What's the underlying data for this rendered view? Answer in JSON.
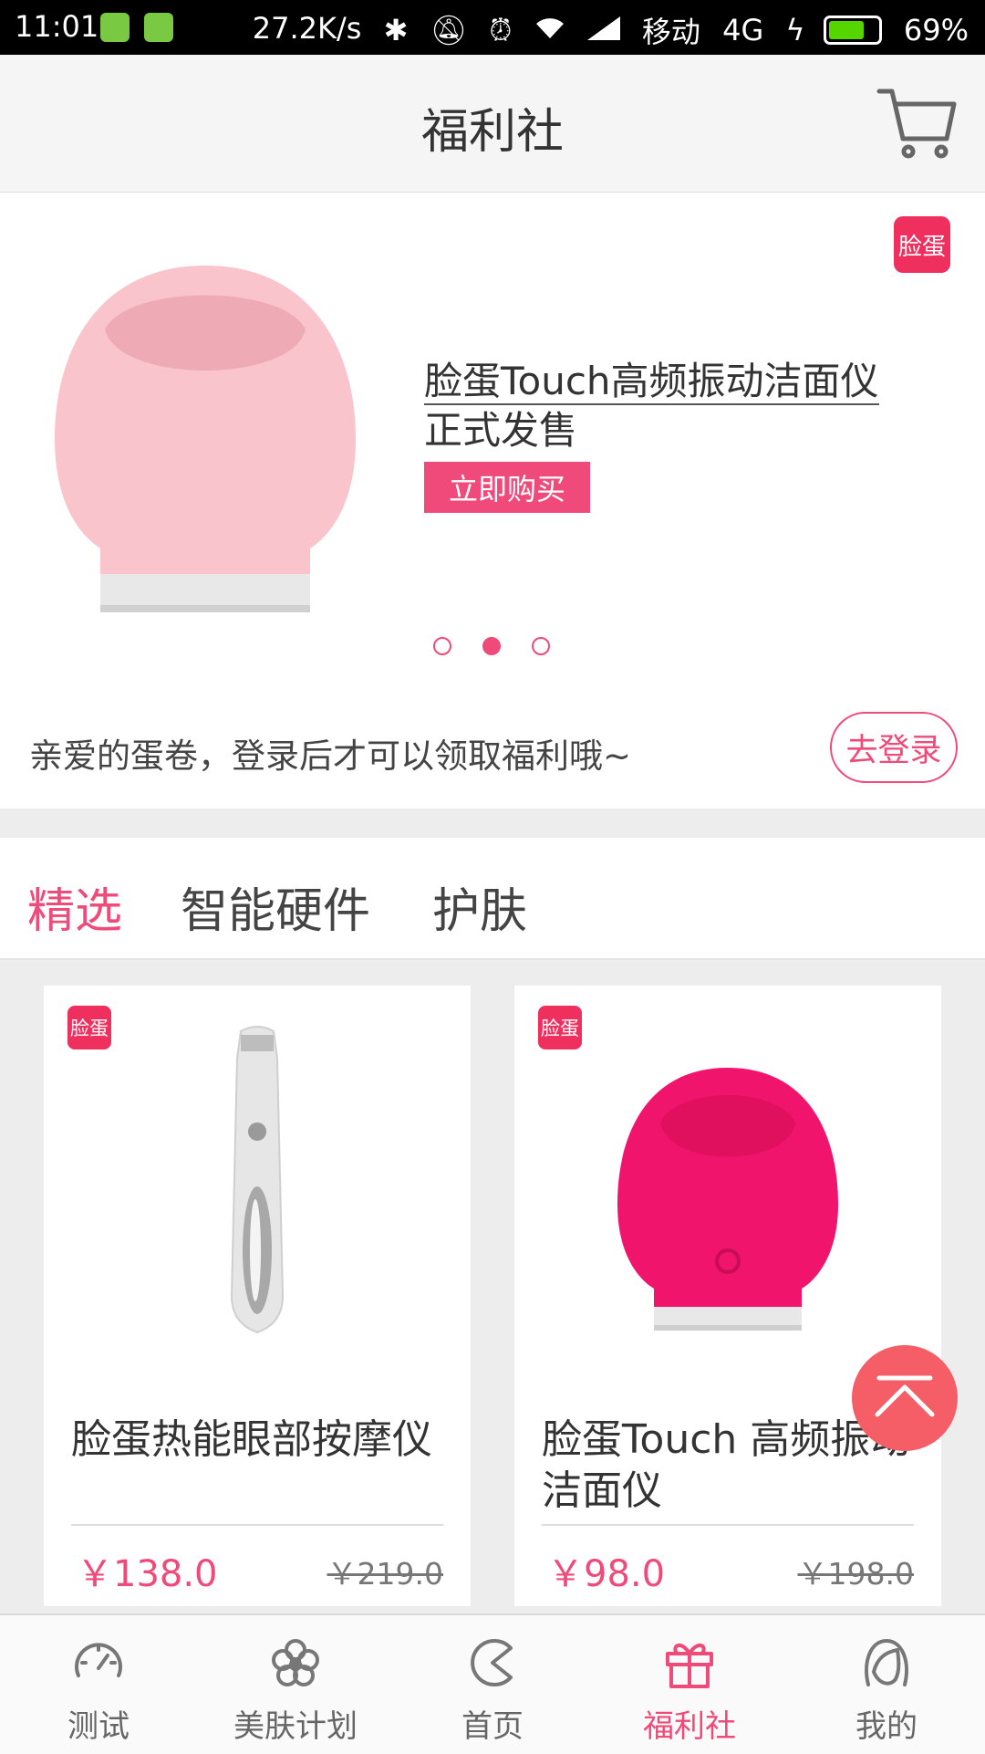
{
  "status_bar": {
    "time": "11:01",
    "speed": "27.2K/s",
    "carrier": "移动",
    "network": "4G",
    "battery": "69%",
    "icons": [
      "battery-app-icon",
      "android-app-icon",
      "bluetooth-icon",
      "mute-bell-icon",
      "alarm-icon",
      "wifi-icon",
      "signal-icon",
      "charging-icon",
      "battery-icon"
    ]
  },
  "header": {
    "title": "福利社",
    "cart_icon": "cart-icon"
  },
  "banner": {
    "brand_badge": "脸蛋",
    "title_line1": "脸蛋Touch高频振动洁面仪",
    "title_line2": "正式发售",
    "buy_label": "立即购买",
    "pagination_active": 2,
    "pagination_count": 3
  },
  "login": {
    "text": "亲爱的蛋卷，登录后才可以领取福利哦~",
    "button": "去登录"
  },
  "tabs": [
    {
      "label": "精选",
      "active": true
    },
    {
      "label": "智能硬件",
      "active": false
    },
    {
      "label": "护肤",
      "active": false
    }
  ],
  "products": [
    {
      "badge": "脸蛋",
      "name": "脸蛋热能眼部按摩仪",
      "price": "￥138.0",
      "old_price": "￥219.0"
    },
    {
      "badge": "脸蛋",
      "name": "脸蛋Touch 高频振动洁面仪",
      "price": "￥98.0",
      "old_price": "￥198.0"
    }
  ],
  "bottom_nav": [
    {
      "label": "测试",
      "icon": "speedometer-icon",
      "active": false
    },
    {
      "label": "美肤计划",
      "icon": "flower-icon",
      "active": false
    },
    {
      "label": "首页",
      "icon": "pacman-icon",
      "active": false
    },
    {
      "label": "福利社",
      "icon": "gift-icon",
      "active": true
    },
    {
      "label": "我的",
      "icon": "girl-face-icon",
      "active": false
    }
  ],
  "colors": {
    "accent": "#ef4a7a",
    "brand_badge": "#ef2f5e",
    "back_to_top": "#f55e66"
  }
}
